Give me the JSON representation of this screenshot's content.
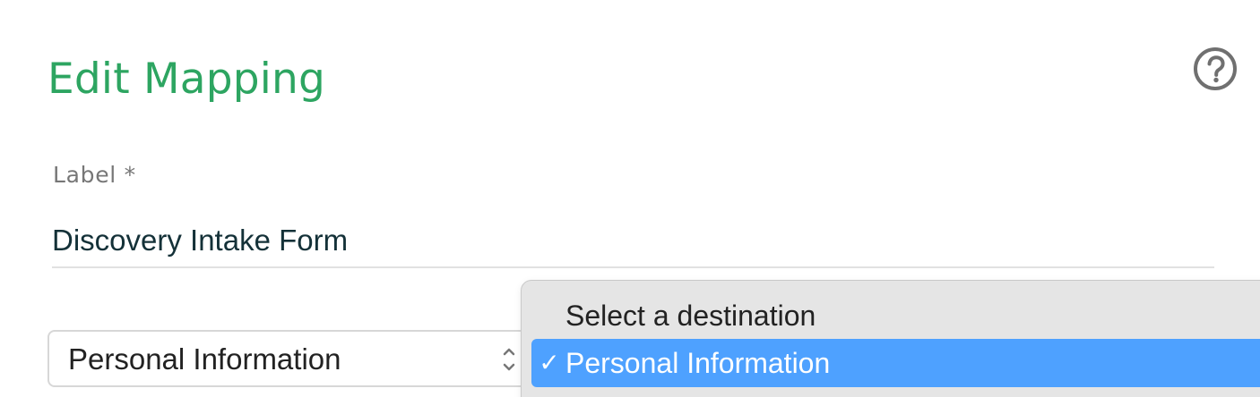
{
  "header": {
    "title": "Edit Mapping",
    "help_icon": "question-circle-icon",
    "help_icon_color": "#707070"
  },
  "form": {
    "label_field": {
      "label": "Label *",
      "value": "Discovery Intake Form"
    },
    "destination_select": {
      "selected_value": "Personal Information",
      "icon": "updown-chevron-icon"
    }
  },
  "dropdown": {
    "placeholder_option": "Select a destination",
    "selected_option": "Personal Information",
    "selected_check": "✓"
  },
  "colors": {
    "title": "#2da561",
    "selection": "#4ea1ff",
    "dropdown_background": "#e5e5e5"
  }
}
